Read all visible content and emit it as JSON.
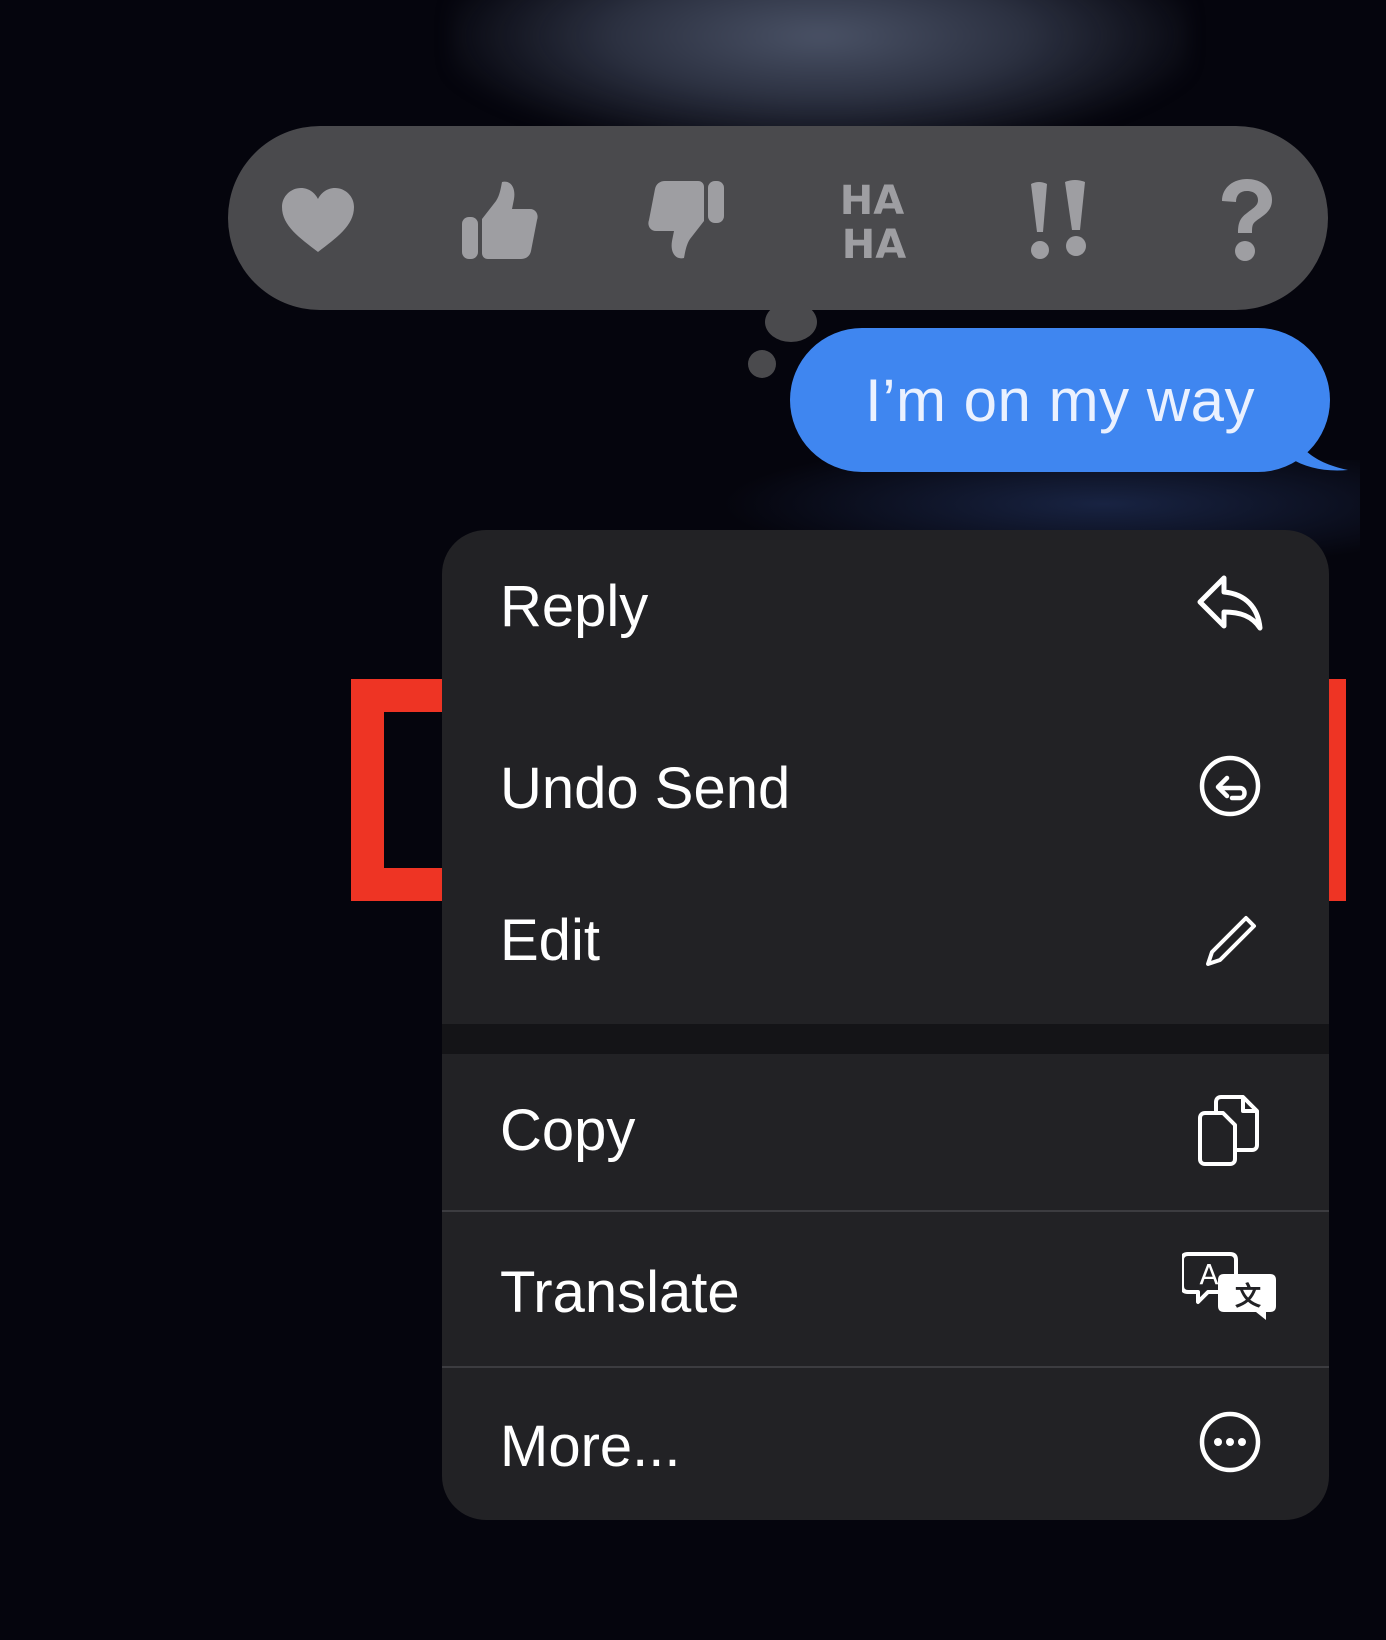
{
  "tapbacks": [
    {
      "name": "heart-icon"
    },
    {
      "name": "thumbs-up-icon"
    },
    {
      "name": "thumbs-down-icon"
    },
    {
      "name": "haha-icon",
      "line1": "HA",
      "line2": "HA"
    },
    {
      "name": "exclamation-icon"
    },
    {
      "name": "question-icon"
    }
  ],
  "message": {
    "text": "I’m on my way",
    "bubble_color": "#3f86f0"
  },
  "menu": {
    "items": [
      {
        "label": "Reply",
        "icon": "reply-arrow-icon"
      },
      {
        "label": "Undo Send",
        "icon": "undo-circle-icon",
        "highlighted": true
      },
      {
        "label": "Edit",
        "icon": "pencil-icon"
      },
      {
        "label": "Copy",
        "icon": "copy-icon"
      },
      {
        "label": "Translate",
        "icon": "translate-icon",
        "icon_letters": [
          "A",
          "文"
        ]
      },
      {
        "label": "More...",
        "icon": "ellipsis-circle-icon"
      }
    ]
  },
  "colors": {
    "background": "#05050d",
    "tapback_bar": "#4a4a4d",
    "tapback_icon": "#9e9ea2",
    "menu_background": "#222225",
    "highlight": "#ee3424"
  }
}
